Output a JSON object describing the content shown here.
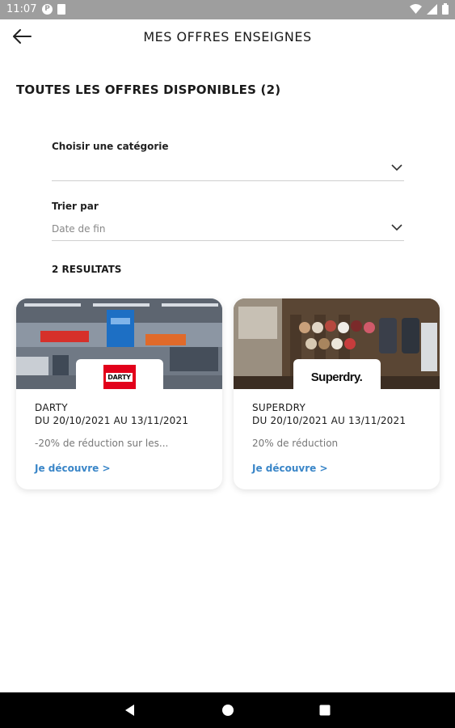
{
  "status_bar": {
    "time": "11:07",
    "icons": [
      "app-notification-icon",
      "sim-card-icon",
      "wifi-icon",
      "signal-icon",
      "battery-icon"
    ]
  },
  "header": {
    "title": "MES OFFRES ENSEIGNES",
    "back_icon": "arrow-left-icon"
  },
  "section": {
    "title": "TOUTES LES OFFRES DISPONIBLES (2)"
  },
  "filters": {
    "category": {
      "label": "Choisir une catégorie",
      "value": ""
    },
    "sort": {
      "label": "Trier par",
      "value": "Date de fin"
    }
  },
  "results": {
    "count_label": "2 RESULTATS"
  },
  "offers": [
    {
      "brand": "DARTY",
      "logo_text": "DARTY",
      "dates": "DU 20/10/2021 AU 13/11/2021",
      "description": "-20% de réduction sur les...",
      "link": "Je découvre >"
    },
    {
      "brand": "SUPERDRY",
      "logo_text": "Superdry.",
      "dates": "DU 20/10/2021 AU 13/11/2021",
      "description": "20% de réduction",
      "link": "Je découvre >"
    }
  ],
  "colors": {
    "status_bar": "#9e9e9e",
    "link": "#3a86c8",
    "darty_red": "#e2001a",
    "nav_bar": "#000000"
  },
  "nav": {
    "icons": [
      "back-triangle-icon",
      "home-circle-icon",
      "recents-square-icon"
    ]
  }
}
